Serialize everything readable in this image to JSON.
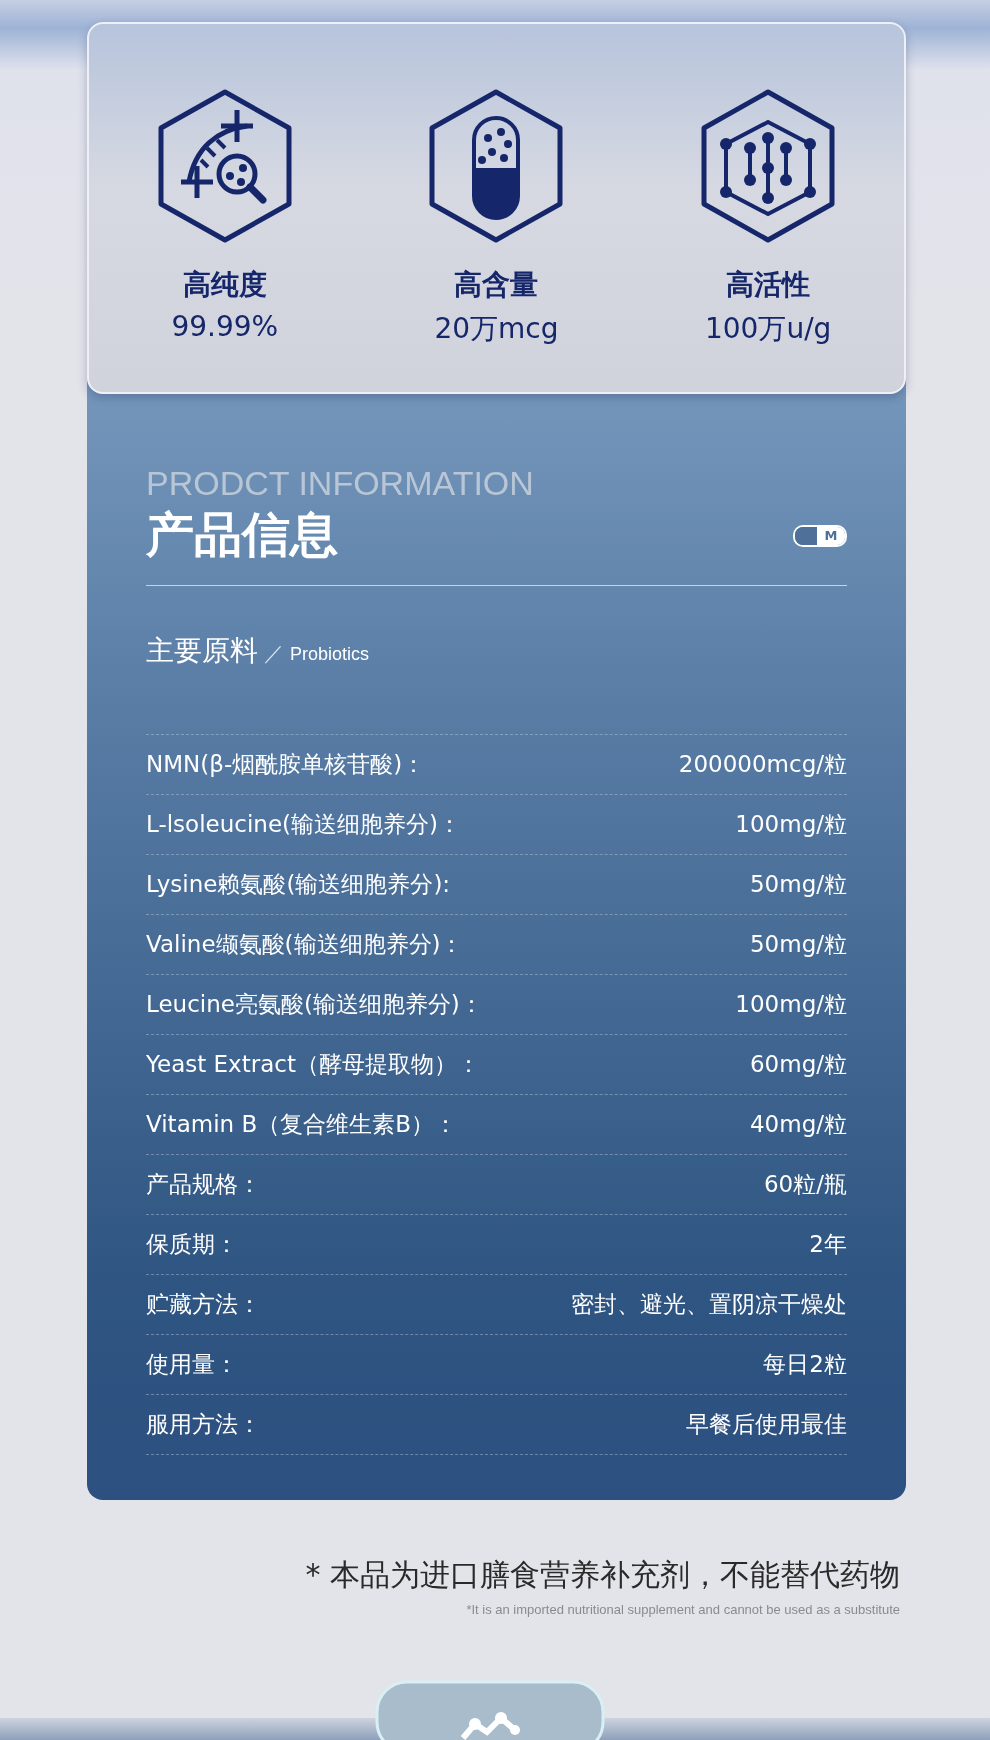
{
  "features": [
    {
      "kind": "magnifier",
      "title": "高纯度",
      "value": "99.99%"
    },
    {
      "kind": "capsule",
      "title": "高含量",
      "value": "20万mcg"
    },
    {
      "kind": "molecule",
      "title": "高活性",
      "value": "100万u/g"
    }
  ],
  "info": {
    "subtitle_en": "PRODCT INFORMATION",
    "title": "产品信息",
    "badge": "M",
    "section_title": "主要原料",
    "section_separator": "／",
    "section_en": "Probiotics",
    "rows": [
      {
        "label": "NMN(β-烟酰胺单核苷酸)：",
        "value": "200000mcg/粒"
      },
      {
        "label": "L-lsoleucine(输送细胞养分)：",
        "value": "100mg/粒"
      },
      {
        "label": "Lysine赖氨酸(输送细胞养分):",
        "value": "50mg/粒"
      },
      {
        "label": "Valine缬氨酸(输送细胞养分)：",
        "value": "50mg/粒"
      },
      {
        "label": "Leucine亮氨酸(输送细胞养分)：",
        "value": "100mg/粒"
      },
      {
        "label": "Yeast Extract（酵母提取物）：",
        "value": "60mg/粒"
      },
      {
        "label": "Vitamin B（复合维生素B）：",
        "value": "40mg/粒"
      },
      {
        "label": "产品规格：",
        "value": "60粒/瓶"
      },
      {
        "label": "保质期：",
        "value": "2年"
      },
      {
        "label": "贮藏方法：",
        "value": "密封、避光、置阴凉干燥处"
      },
      {
        "label": "使用量：",
        "value": "每日2粒"
      },
      {
        "label": "服用方法：",
        "value": "早餐后使用最佳"
      }
    ]
  },
  "footer": {
    "note": "* 本品为进口膳食营养补充剂，不能替代药物",
    "note_en": "*It is an imported nutritional supplement and cannot be used as a substitute"
  }
}
